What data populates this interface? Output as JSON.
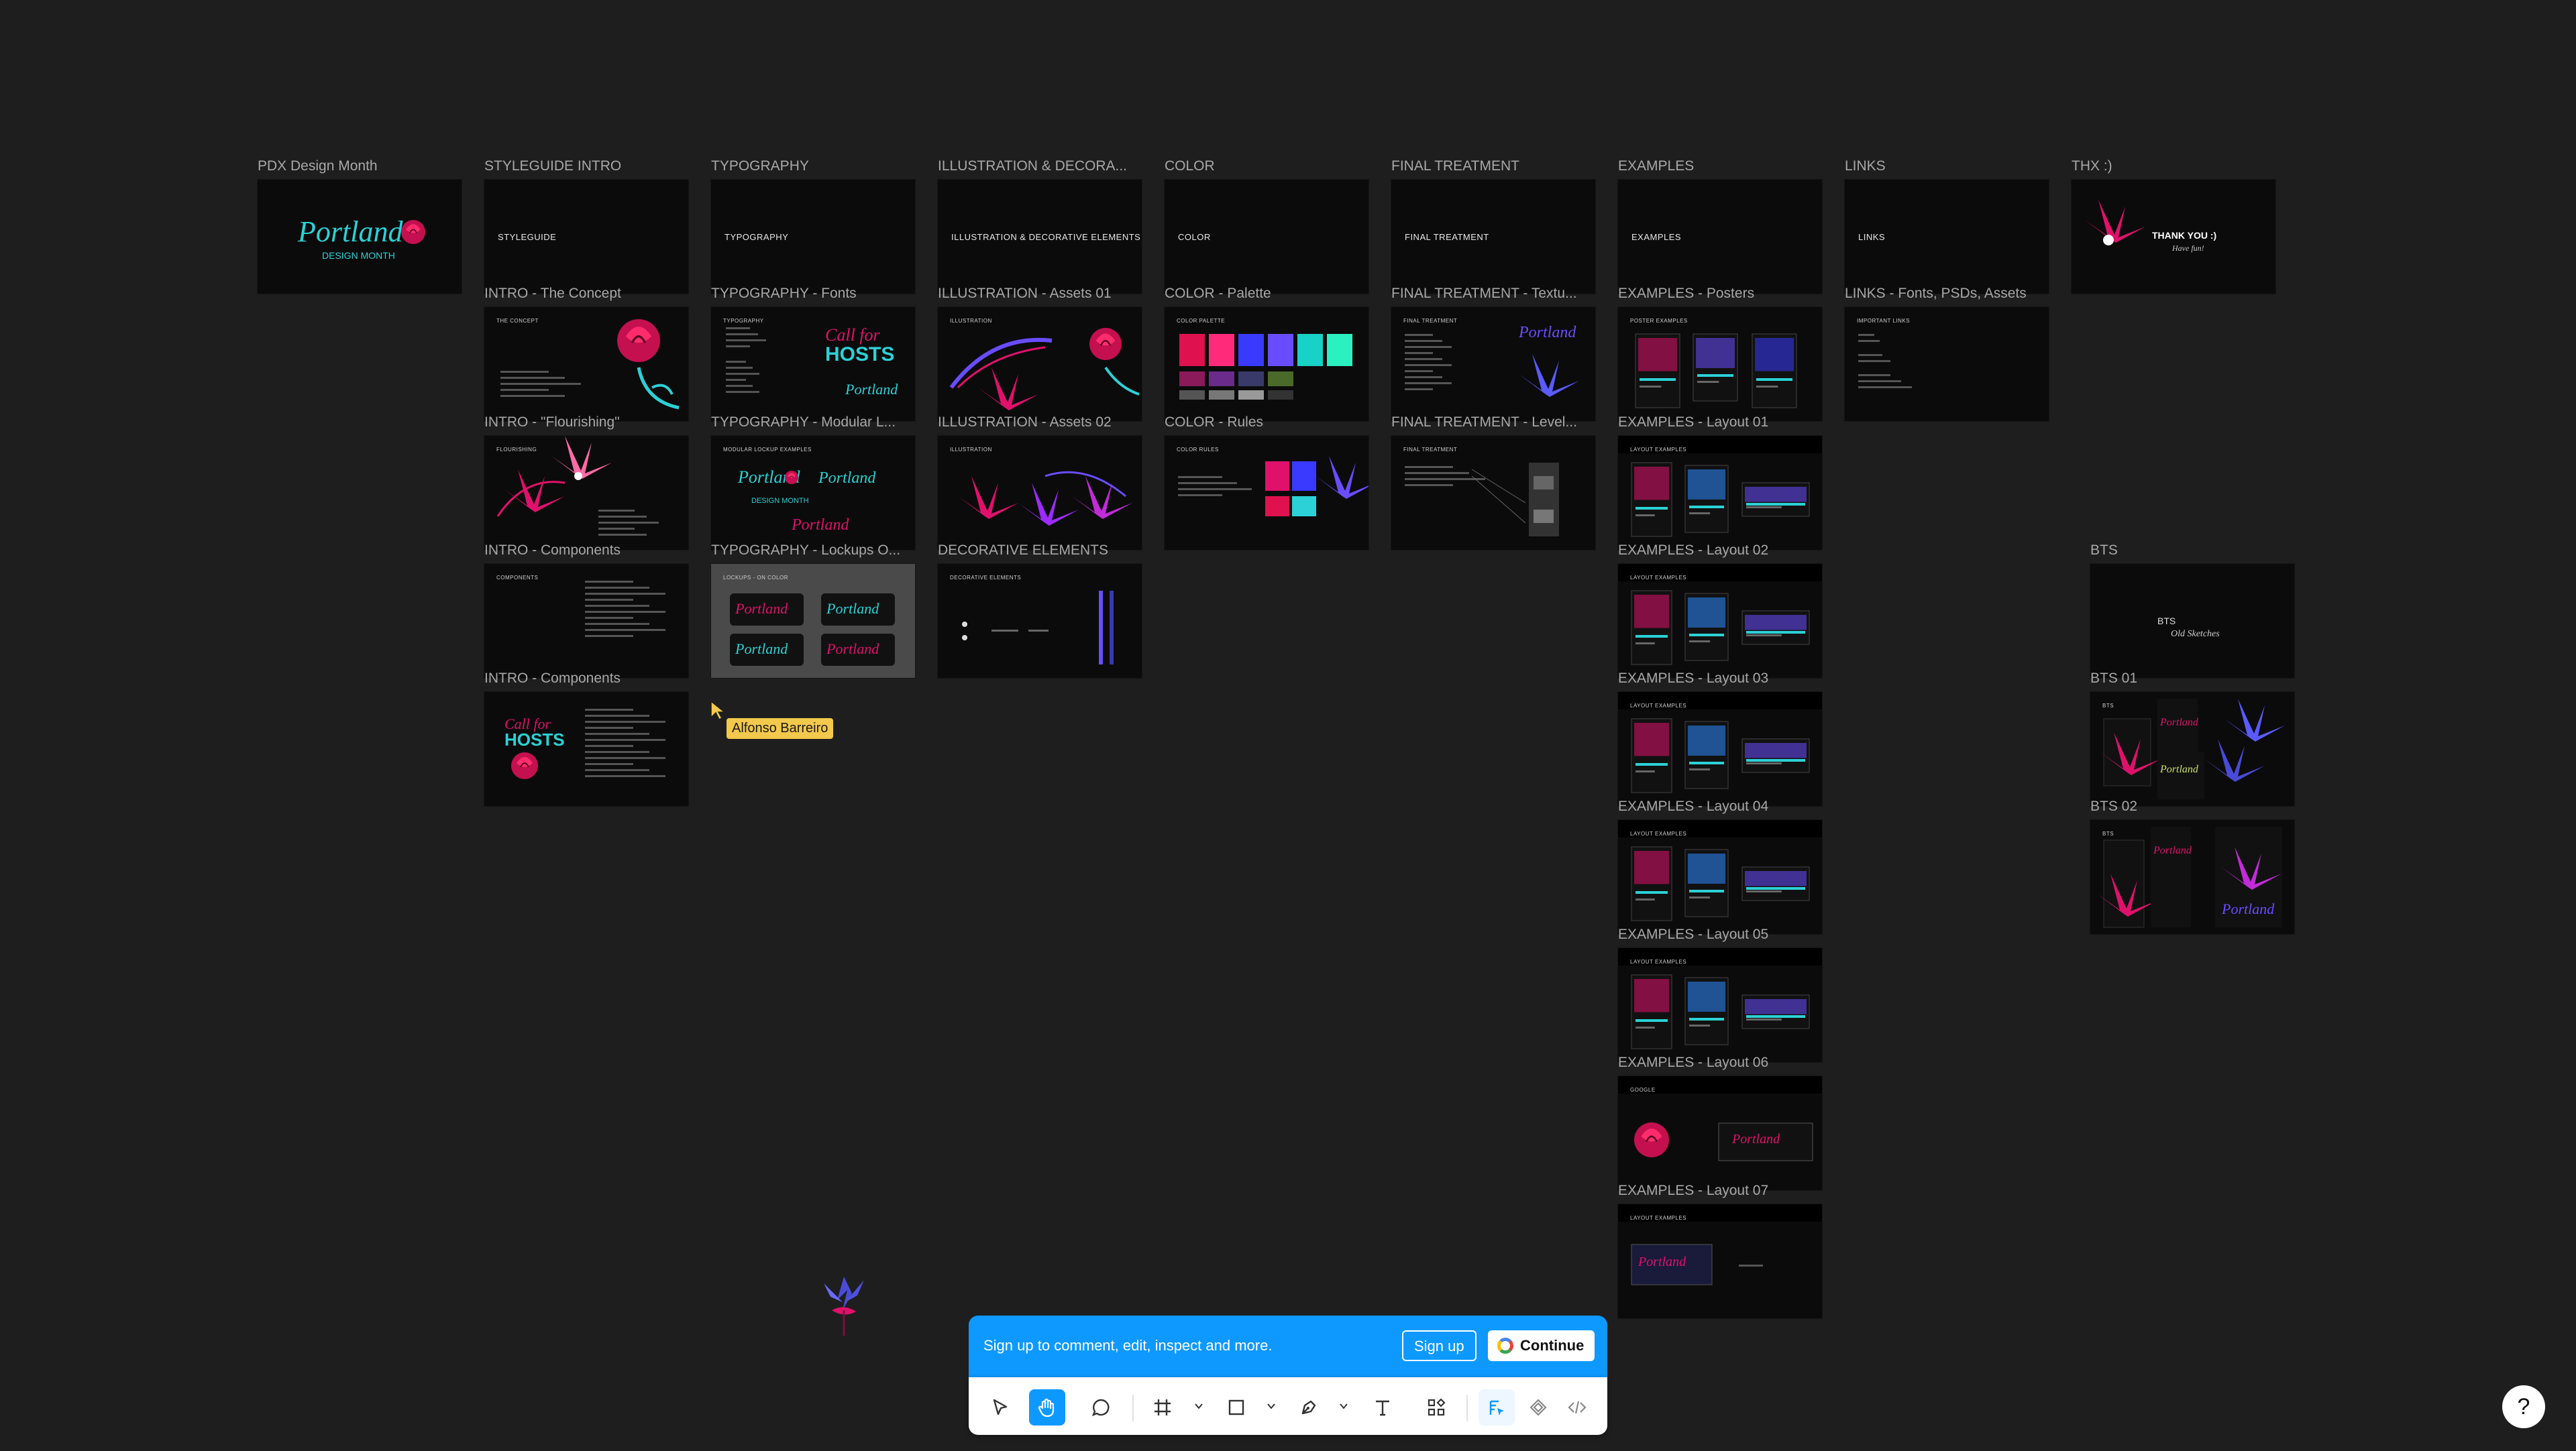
{
  "frames": [
    {
      "label": "PDX Design Month",
      "title": "Portland DESIGN MONTH",
      "kind": "cover"
    },
    {
      "label": "STYLEGUIDE INTRO",
      "title": "STYLEGUIDE",
      "kind": "text"
    },
    {
      "label": "TYPOGRAPHY",
      "title": "TYPOGRAPHY",
      "kind": "text"
    },
    {
      "label": "ILLUSTRATION & DECORA...",
      "title": "ILLUSTRATION & DECORATIVE ELEMENTS",
      "kind": "text"
    },
    {
      "label": "COLOR",
      "title": "COLOR",
      "kind": "text"
    },
    {
      "label": "FINAL TREATMENT",
      "title": "FINAL TREATMENT",
      "kind": "text"
    },
    {
      "label": "EXAMPLES",
      "title": "EXAMPLES",
      "kind": "text"
    },
    {
      "label": "LINKS",
      "title": "LINKS",
      "kind": "text"
    },
    {
      "label": "THX :)",
      "title": "THANK YOU :)",
      "kind": "thanks"
    },
    {
      "label": "INTRO - The Concept",
      "title": "THE CONCEPT",
      "kind": "rose"
    },
    {
      "label": "TYPOGRAPHY - Fonts",
      "title": "TYPOGRAPHY",
      "kind": "fonts"
    },
    {
      "label": "ILLUSTRATION - Assets 01",
      "title": "ILLUSTRATION",
      "kind": "illus"
    },
    {
      "label": "COLOR - Palette",
      "title": "COLOR PALETTE",
      "kind": "palette"
    },
    {
      "label": "FINAL TREATMENT - Textu...",
      "title": "FINAL TREATMENT",
      "kind": "treat"
    },
    {
      "label": "EXAMPLES - Posters",
      "title": "POSTER EXAMPLES",
      "kind": "posters"
    },
    {
      "label": "LINKS - Fonts, PSDs, Assets",
      "title": "IMPORTANT LINKS",
      "kind": "links"
    },
    {
      "label": "INTRO - \"Flourishing\"",
      "title": "FLOURISHING",
      "kind": "flourish"
    },
    {
      "label": "TYPOGRAPHY - Modular L...",
      "title": "MODULAR LOCKUP EXAMPLES",
      "kind": "modular"
    },
    {
      "label": "ILLUSTRATION - Assets 02",
      "title": "ILLUSTRATION",
      "kind": "illus2"
    },
    {
      "label": "COLOR - Rules",
      "title": "COLOR RULES",
      "kind": "rules"
    },
    {
      "label": "FINAL TREATMENT - Level...",
      "title": "FINAL TREATMENT",
      "kind": "levels"
    },
    {
      "label": "EXAMPLES - Layout 01",
      "title": "LAYOUT EXAMPLES",
      "kind": "layout"
    },
    {
      "label": "INTRO - Components",
      "title": "COMPONENTS",
      "kind": "components"
    },
    {
      "label": "TYPOGRAPHY - Lockups O...",
      "title": "LOCKUPS - ON COLOR",
      "kind": "lockups"
    },
    {
      "label": "DECORATIVE ELEMENTS",
      "title": "DECORATIVE ELEMENTS",
      "kind": "decorative"
    },
    {
      "label": "EXAMPLES - Layout 02",
      "title": "LAYOUT EXAMPLES",
      "kind": "layout"
    },
    {
      "label": "BTS",
      "title": "BTS Old Sketches",
      "kind": "bts"
    },
    {
      "label": "INTRO - Components",
      "title": "",
      "kind": "components2"
    },
    {
      "label": "EXAMPLES - Layout 03",
      "title": "LAYOUT EXAMPLES",
      "kind": "layout"
    },
    {
      "label": "BTS 01",
      "title": "BTS",
      "kind": "bts01"
    },
    {
      "label": "EXAMPLES - Layout 04",
      "title": "LAYOUT EXAMPLES",
      "kind": "layout"
    },
    {
      "label": "BTS 02",
      "title": "BTS",
      "kind": "bts02"
    },
    {
      "label": "EXAMPLES - Layout 05",
      "title": "LAYOUT EXAMPLES",
      "kind": "layout"
    },
    {
      "label": "EXAMPLES - Layout 06",
      "title": "GOOGLE",
      "kind": "layout6"
    },
    {
      "label": "EXAMPLES - Layout 07",
      "title": "LAYOUT EXAMPLES",
      "kind": "layout7"
    }
  ],
  "collaborator": {
    "name": "Alfonso Barreiro",
    "color": "#f2c94c"
  },
  "banner": {
    "text": "Sign up to comment, edit, inspect and more.",
    "signup": "Sign up",
    "continue": "Continue"
  },
  "toolbar": {
    "tools": [
      "move-tool",
      "hand-tool",
      "comment-tool",
      "frame-tool",
      "shape-tool",
      "pen-tool",
      "text-tool",
      "resources-tool",
      "dev-ready-tool",
      "component-tool",
      "code-tool"
    ],
    "active": "hand-tool"
  },
  "help": "?",
  "colors": {
    "canvas": "#1e1e1e",
    "accent": "#0d99ff",
    "pink": "#e0116b",
    "cyan": "#2bd1d6",
    "violet": "#6a4cff"
  }
}
